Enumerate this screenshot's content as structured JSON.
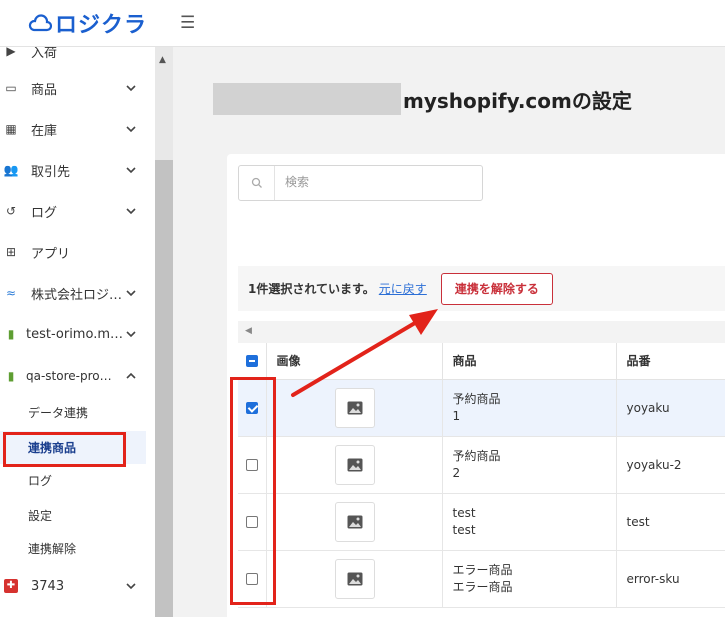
{
  "brand": {
    "logo_text": "ロジクラ",
    "accent": "#1a5fcf"
  },
  "topbar": {
    "menu_icon": "☰"
  },
  "sidebar": {
    "partial_label": "入荷",
    "items": [
      {
        "icon": "▭",
        "label": "商品"
      },
      {
        "icon": "▦",
        "label": "在庫"
      },
      {
        "icon": "👥",
        "label": "取引先"
      },
      {
        "icon": "↺",
        "label": "ログ"
      },
      {
        "icon": "⊞",
        "label": "アプリ"
      },
      {
        "icon": "≈",
        "label": "株式会社ロジ…"
      },
      {
        "icon": "▮",
        "label": "test-orimo.m…"
      },
      {
        "icon": "▮",
        "label": "qa-store-pro…"
      }
    ],
    "sub_items": [
      {
        "label": "データ連携"
      },
      {
        "label": "連携商品"
      },
      {
        "label": "ログ"
      },
      {
        "label": "設定"
      },
      {
        "label": "連携解除"
      }
    ],
    "last_item": {
      "icon": "✚",
      "label": "3743"
    }
  },
  "page": {
    "title": "myshopify.comの設定"
  },
  "search": {
    "placeholder": "検索"
  },
  "selection": {
    "text": "1件選択されています。",
    "undo_link": "元に戻す",
    "unlink_button": "連携を解除する"
  },
  "table": {
    "headers": [
      "画像",
      "商品",
      "品番"
    ],
    "rows": [
      {
        "name_line1": "予約商品",
        "name_line2": "1",
        "sku": "yoyaku",
        "checked": true
      },
      {
        "name_line1": "予約商品",
        "name_line2": "2",
        "sku": "yoyaku-2",
        "checked": false
      },
      {
        "name_line1": "test",
        "name_line2": "test",
        "sku": "test",
        "checked": false
      },
      {
        "name_line1": "エラー商品",
        "name_line2": "エラー商品",
        "sku": "error-sku",
        "checked": false
      }
    ]
  },
  "colors": {
    "annotation": "#e2231a",
    "danger": "#c9303a",
    "link": "#2c6fd6"
  }
}
